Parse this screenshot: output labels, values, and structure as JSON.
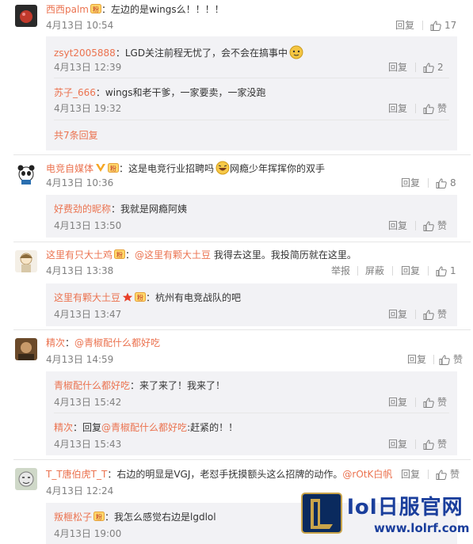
{
  "actions": {
    "report": "举报",
    "block": "屏蔽",
    "reply": "回复",
    "like_zero": "赞"
  },
  "comments": [
    {
      "user": "西西palm",
      "sep": "：",
      "text": "左边的是wings么！！！！",
      "time": "4月13日 10:54",
      "likes": "17",
      "replies": [
        {
          "user": "zsyt2005888",
          "sep": "：",
          "text": "LGD关注前程无忧了，会不会在搞事中",
          "time": "4月13日 12:39",
          "likes": "2"
        },
        {
          "user": "苏子_666",
          "sep": "：",
          "text": "wings和老干爹，一家要卖，一家没跑",
          "time": "4月13日 19:32",
          "likes": "赞"
        }
      ],
      "more": "共7条回复"
    },
    {
      "user": "电竞自媒体",
      "sep": "：",
      "text": "这是电竞行业招聘吗",
      "text2": "网瘾少年挥挥你的双手",
      "time": "4月13日 10:36",
      "likes": "8",
      "replies": [
        {
          "user": "好费劲的昵称",
          "sep": "：",
          "text": "我就是网瘾阿姨",
          "time": "4月13日 13:50",
          "likes": "赞"
        }
      ]
    },
    {
      "user": "这里有只大土鸡",
      "sep": "：",
      "mention": "@这里有颗大土豆",
      "text": " 我得去这里。我投简历就在这里。",
      "time": "4月13日 13:38",
      "likes": "1",
      "replies": [
        {
          "user": "这里有颗大土豆",
          "sep": "：",
          "text": "杭州有电竞战队的吧",
          "time": "4月13日 13:47",
          "likes": "赞"
        }
      ]
    },
    {
      "user": "精次",
      "sep": "：",
      "mention": "@青椒配什么都好吃",
      "text": "",
      "time": "4月13日 14:59",
      "likes": "赞",
      "replies": [
        {
          "user": "青椒配什么都好吃",
          "sep": "：",
          "text": "来了来了！我来了！",
          "time": "4月13日 15:42",
          "likes": "赞"
        },
        {
          "user": "精次",
          "sep": "：",
          "pre": "回复",
          "mention": "@青椒配什么都好吃",
          "text": ":赶紧的！！",
          "time": "4月13日 15:43",
          "likes": "赞"
        }
      ]
    },
    {
      "user": "T_T唐伯虎T_T",
      "sep": "：",
      "text": "右边的明显是VGJ，老怼手抚摸额头这么招牌的动作。",
      "mention": "@rOtK白帆",
      "time": "4月13日 12:24",
      "likes": "赞",
      "replies": [
        {
          "user": "叛榧松子",
          "sep": "：",
          "text": "我怎么感觉右边是lgdlol",
          "time": "4月13日 19:00",
          "likes": ""
        }
      ]
    }
  ],
  "watermark": {
    "title": "lol日服官网",
    "url": "www.lolrf.com"
  },
  "colors": {
    "accent": "#eb7350",
    "muted": "#808080",
    "reply_bg": "#f2f2f5"
  }
}
